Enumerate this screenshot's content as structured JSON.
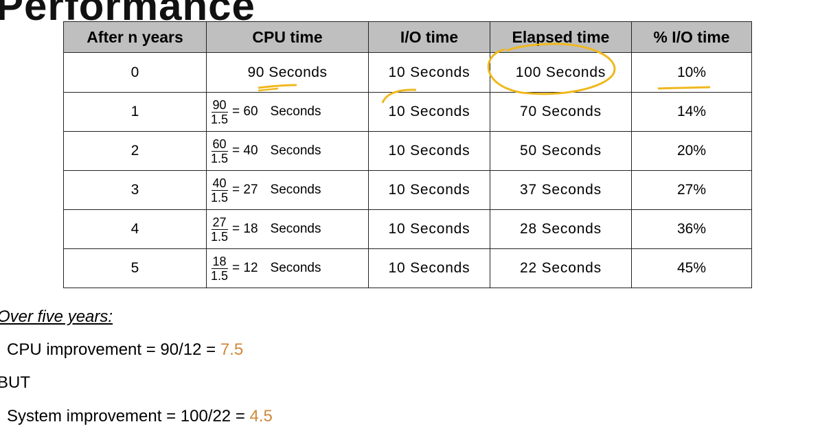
{
  "title": "Performance",
  "table": {
    "headers": [
      "After n years",
      "CPU time",
      "I/O time",
      "Elapsed time",
      "% I/O time"
    ],
    "rows": [
      {
        "n": "0",
        "cpu_text": "90  Seconds",
        "io": "10  Seconds",
        "elapsed": "100  Seconds",
        "pct": "10%"
      },
      {
        "n": "1",
        "frac_num": "90",
        "frac_den": "1.5",
        "cpu_result": "= 60",
        "cpu_unit": "Seconds",
        "io": "10  Seconds",
        "elapsed": "70  Seconds",
        "pct": "14%"
      },
      {
        "n": "2",
        "frac_num": "60",
        "frac_den": "1.5",
        "cpu_result": "= 40",
        "cpu_unit": "Seconds",
        "io": "10  Seconds",
        "elapsed": "50  Seconds",
        "pct": "20%"
      },
      {
        "n": "3",
        "frac_num": "40",
        "frac_den": "1.5",
        "cpu_result": "= 27",
        "cpu_unit": "Seconds",
        "io": "10  Seconds",
        "elapsed": "37  Seconds",
        "pct": "27%"
      },
      {
        "n": "4",
        "frac_num": "27",
        "frac_den": "1.5",
        "cpu_result": "= 18",
        "cpu_unit": "Seconds",
        "io": "10  Seconds",
        "elapsed": "28  Seconds",
        "pct": "36%"
      },
      {
        "n": "5",
        "frac_num": "18",
        "frac_den": "1.5",
        "cpu_result": "= 12",
        "cpu_unit": "Seconds",
        "io": "10  Seconds",
        "elapsed": "22  Seconds",
        "pct": "45%"
      }
    ]
  },
  "summary": {
    "heading": "Over five years:",
    "cpu_label": "CPU improvement = 90/12 = ",
    "cpu_value": "7.5",
    "but": "BUT",
    "sys_label": "System improvement = 100/22 = ",
    "sys_value": "4.5"
  },
  "colors": {
    "highlight": "#d0883a",
    "header_bg": "#bfbfbf",
    "annotation": "#f0b81c"
  }
}
